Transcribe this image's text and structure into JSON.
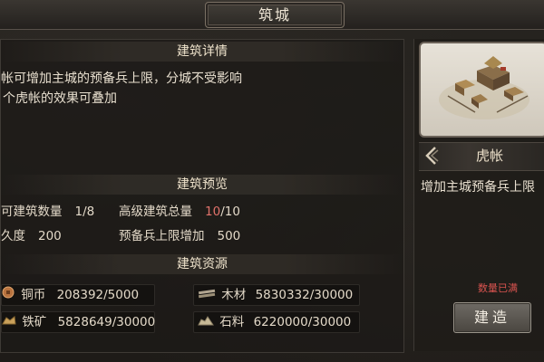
{
  "window": {
    "title": "筑城"
  },
  "details": {
    "header": "建筑详情",
    "line1": "帐可增加主城的预备兵上限，分城不受影响",
    "line2": "个虎帐的效果可叠加"
  },
  "preview": {
    "header": "建筑预览",
    "build_count_label": "可建筑数量",
    "build_count_value": "1/8",
    "advanced_label": "高级建筑总量",
    "advanced_used": "10",
    "advanced_total": "/10",
    "durability_label": "久度",
    "durability_value": "200",
    "reserve_label": "预备兵上限增加",
    "reserve_value": "500"
  },
  "resources": {
    "header": "建筑资源",
    "items": [
      {
        "icon": "copper-coin-icon",
        "label": "铜币",
        "value": "208392/5000"
      },
      {
        "icon": "wood-icon",
        "label": "木材",
        "value": "5830332/30000"
      },
      {
        "icon": "iron-ore-icon",
        "label": "铁矿",
        "value": "5828649/30000"
      },
      {
        "icon": "stone-icon",
        "label": "石料",
        "value": "6220000/30000"
      }
    ]
  },
  "building": {
    "name": "虎帐",
    "description": "增加主城预备兵上限",
    "status": "数量已满",
    "build_button": "建造"
  },
  "colors": {
    "highlight": "#e0726a",
    "status_red": "#d9534f"
  }
}
